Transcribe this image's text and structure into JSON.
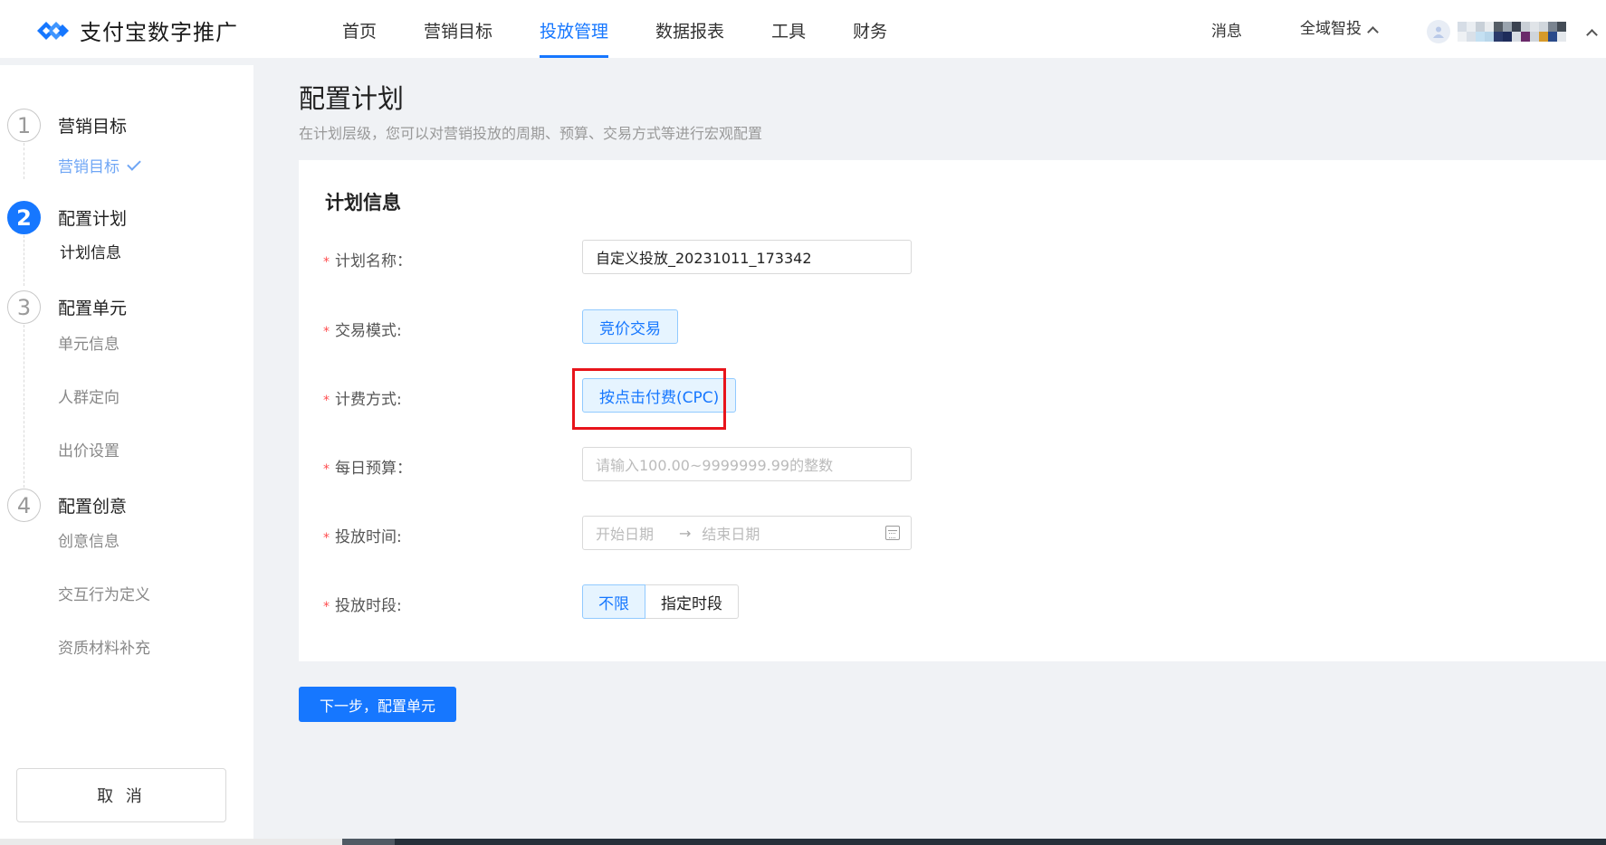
{
  "brand": {
    "name": "支付宝数字推广",
    "color": "#1677ff"
  },
  "nav": {
    "items": [
      {
        "label": "首页",
        "active": false
      },
      {
        "label": "营销目标",
        "active": false
      },
      {
        "label": "投放管理",
        "active": true
      },
      {
        "label": "数据报表",
        "active": false
      },
      {
        "label": "工具",
        "active": false
      },
      {
        "label": "财务",
        "active": false
      }
    ],
    "messages": "消息",
    "scope": "全域智投"
  },
  "sidebar": {
    "steps": [
      {
        "num": "1",
        "title": "营销目标",
        "active": false,
        "subs": [
          {
            "label": "营销目标",
            "state": "done"
          }
        ]
      },
      {
        "num": "2",
        "title": "配置计划",
        "active": true,
        "subs": [
          {
            "label": "计划信息",
            "state": "current"
          }
        ]
      },
      {
        "num": "3",
        "title": "配置单元",
        "active": false,
        "subs": [
          {
            "label": "单元信息"
          },
          {
            "label": "人群定向"
          },
          {
            "label": "出价设置"
          }
        ]
      },
      {
        "num": "4",
        "title": "配置创意",
        "active": false,
        "subs": [
          {
            "label": "创意信息"
          },
          {
            "label": "交互行为定义"
          },
          {
            "label": "资质材料补充"
          }
        ]
      }
    ],
    "cancel": "取 消"
  },
  "page": {
    "title": "配置计划",
    "desc": "在计划层级，您可以对营销投放的周期、预算、交易方式等进行宏观配置"
  },
  "form": {
    "section_title": "计划信息",
    "required_mark": "*",
    "plan_name": {
      "label": "计划名称：",
      "value": "自定义投放_20231011_173342"
    },
    "trade_mode": {
      "label": "交易模式:",
      "value": "竞价交易"
    },
    "billing": {
      "label": "计费方式:",
      "value": "按点击付费(CPC)"
    },
    "budget": {
      "label": "每日预算：",
      "placeholder": "请输入100.00~9999999.99的整数"
    },
    "time": {
      "label": "投放时间:",
      "start_placeholder": "开始日期",
      "arrow": "→",
      "end_placeholder": "结束日期"
    },
    "period": {
      "label": "投放时段:",
      "options": [
        "不限",
        "指定时段"
      ],
      "selected": "不限"
    }
  },
  "next_button": "下一步，配置单元",
  "icons": [
    "brand-logo-icon",
    "chevron-up-icon",
    "user-avatar-icon",
    "checkmark-icon",
    "calendar-icon"
  ]
}
